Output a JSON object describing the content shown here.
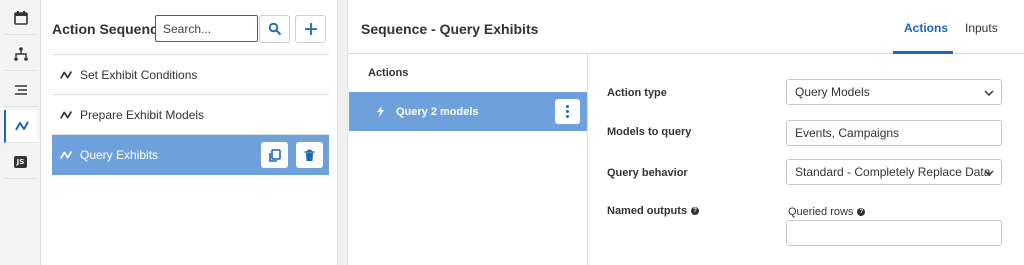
{
  "rail": {
    "items": [
      {
        "icon": "calendar-icon",
        "active": false
      },
      {
        "icon": "hierarchy-icon",
        "active": false
      },
      {
        "icon": "list-lines-icon",
        "active": false
      },
      {
        "icon": "sequence-icon",
        "active": true
      },
      {
        "icon": "js-icon",
        "active": false,
        "label": "JS"
      }
    ]
  },
  "sequences_panel": {
    "title": "Action Sequences",
    "search": {
      "placeholder": "Search...",
      "value": ""
    },
    "items": [
      {
        "label": "Set Exhibit Conditions",
        "active": false
      },
      {
        "label": "Prepare Exhibit Models",
        "active": false
      },
      {
        "label": "Query Exhibits",
        "active": true
      }
    ]
  },
  "detail_panel": {
    "title": "Sequence - Query Exhibits",
    "tabs": [
      {
        "label": "Actions",
        "active": true
      },
      {
        "label": "Inputs",
        "active": false
      }
    ],
    "actions_label": "Actions",
    "action_item": "Query 2 models",
    "form": {
      "action_type": {
        "label": "Action type",
        "value": "Query Models"
      },
      "models_to_query": {
        "label": "Models to query",
        "value": "Events, Campaigns"
      },
      "query_behavior": {
        "label": "Query behavior",
        "value": "Standard - Completely Replace Data"
      },
      "named_outputs": {
        "label": "Named outputs",
        "sub_label": "Queried rows",
        "value": ""
      }
    }
  },
  "colors": {
    "accent": "#1b67b8",
    "selected_row": "#6ea1dc"
  }
}
